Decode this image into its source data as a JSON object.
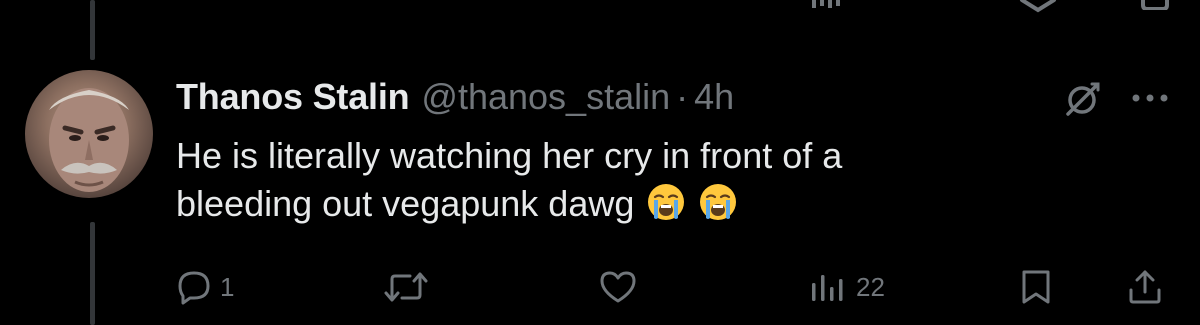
{
  "tweet": {
    "display_name": "Thanos Stalin",
    "handle": "@thanos_stalin",
    "separator": "·",
    "time": "4h",
    "text_line1": "He is literally watching her cry in front of a",
    "text_line2": "bleeding out vegapunk dawg",
    "emojis": [
      "loudly-crying-face",
      "loudly-crying-face"
    ]
  },
  "actions": {
    "reply_count": "1",
    "views_count": "22"
  },
  "icons": {
    "reply": "reply-icon",
    "retweet": "retweet-icon",
    "like": "heart-icon",
    "views": "views-icon",
    "bookmark": "bookmark-icon",
    "share": "share-icon",
    "grok": "grok-icon",
    "more": "more-icon"
  },
  "colors": {
    "background": "#000000",
    "primary_text": "#e7e9ea",
    "secondary_text": "#71767b",
    "thread_line": "#333639",
    "emoji_face": "#ffc83d",
    "emoji_tears": "#5aa7e6"
  }
}
